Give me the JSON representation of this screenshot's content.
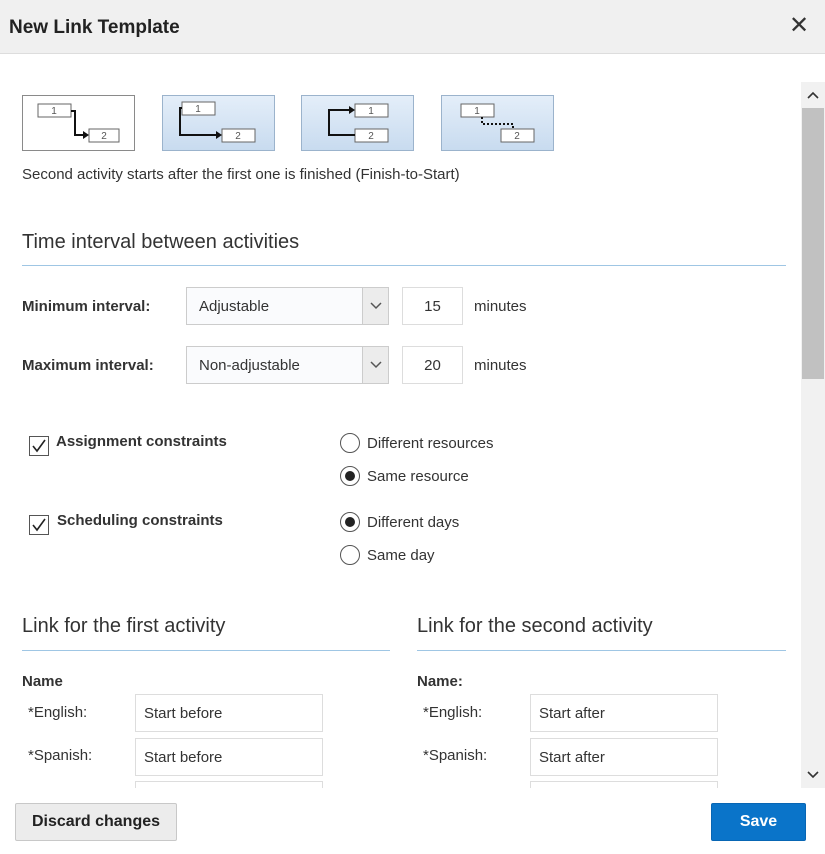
{
  "dialog": {
    "title": "New Link Template",
    "close_glyph": "✕"
  },
  "link_types": {
    "selected": "finish-to-start",
    "description": "Second activity starts after the first one is finished (Finish-to-Start)",
    "items": [
      {
        "id": "finish-to-start",
        "box1": "1",
        "box2": "2"
      },
      {
        "id": "start-to-finish",
        "box1": "1",
        "box2": "2"
      },
      {
        "id": "start-to-start",
        "box1": "1",
        "box2": "2"
      },
      {
        "id": "simultaneous",
        "box1": "1",
        "box2": "2"
      }
    ]
  },
  "time_interval": {
    "title": "Time interval between activities",
    "minimum": {
      "label": "Minimum interval:",
      "mode": "Adjustable",
      "value": "15",
      "unit": "minutes"
    },
    "maximum": {
      "label": "Maximum interval:",
      "mode": "Non-adjustable",
      "value": "20",
      "unit": "minutes"
    }
  },
  "constraints": {
    "assignment": {
      "label": "Assignment constraints",
      "checked": true,
      "options": [
        "Different resources",
        "Same resource"
      ],
      "selected": "Same resource"
    },
    "scheduling": {
      "label": "Scheduling constraints",
      "checked": true,
      "options": [
        "Different days",
        "Same day"
      ],
      "selected": "Different days"
    }
  },
  "first_link": {
    "title": "Link for the first activity",
    "name_heading": "Name",
    "english_label": "*English:",
    "english_value": "Start before",
    "spanish_label": "*Spanish:",
    "spanish_value": "Start before"
  },
  "second_link": {
    "title": "Link for the second activity",
    "name_heading": "Name:",
    "english_label": "*English:",
    "english_value": "Start after",
    "spanish_label": "*Spanish:",
    "spanish_value": "Start after"
  },
  "footer": {
    "discard_label": "Discard changes",
    "save_label": "Save"
  },
  "colors": {
    "save_button": "#0a74c9",
    "section_line": "#9fc6e4",
    "header_bg": "#f0f0f0"
  }
}
